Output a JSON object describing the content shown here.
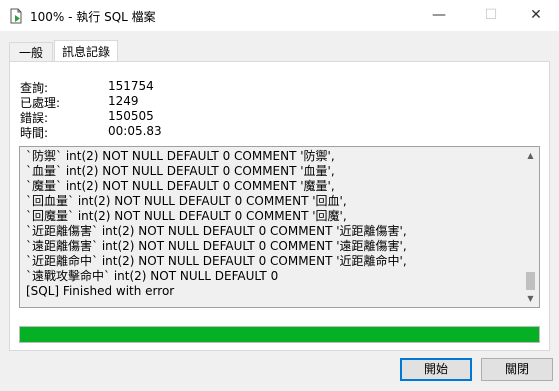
{
  "window": {
    "title": "100% - 執行 SQL 檔案",
    "minimize_glyph": "—",
    "maximize_glyph": "☐",
    "close_glyph": "✕"
  },
  "tabs": [
    {
      "label": "一般",
      "active": false
    },
    {
      "label": "訊息記錄",
      "active": true
    }
  ],
  "stats": [
    {
      "label": "查詢:",
      "value": "151754"
    },
    {
      "label": "已處理:",
      "value": "1249"
    },
    {
      "label": "錯誤:",
      "value": "150505"
    },
    {
      "label": "時間:",
      "value": "00:05.83"
    }
  ],
  "log": {
    "lines": [
      "`防禦` int(2) NOT NULL DEFAULT 0 COMMENT '防禦',",
      "`血量` int(2) NOT NULL DEFAULT 0 COMMENT '血量',",
      "`魔量` int(2) NOT NULL DEFAULT 0 COMMENT '魔量',",
      "`回血量` int(2) NOT NULL DEFAULT 0 COMMENT '回血',",
      "`回魔量` int(2) NOT NULL DEFAULT 0 COMMENT '回魔',",
      "`近距離傷害` int(2) NOT NULL DEFAULT 0 COMMENT '近距離傷害',",
      "`遠距離傷害` int(2) NOT NULL DEFAULT 0 COMMENT '遠距離傷害',",
      "`近距離命中` int(2) NOT NULL DEFAULT 0 COMMENT '近距離命中',",
      "`遠戰攻擊命中` int(2) NOT NULL DEFAULT 0",
      "[SQL] Finished with error"
    ],
    "scroll_position": 1.0
  },
  "progress": {
    "percent": 100,
    "color": "#06b025"
  },
  "buttons": {
    "start": "開始",
    "close": "關閉"
  },
  "colors": {
    "accent": "#0078d7",
    "progress": "#06b025"
  }
}
